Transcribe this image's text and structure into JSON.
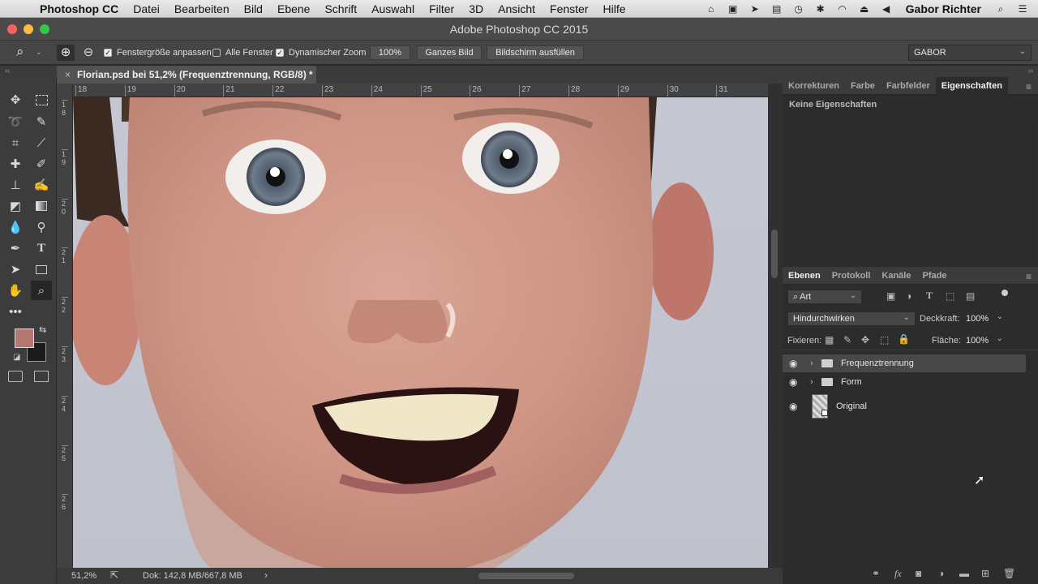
{
  "menubar": {
    "app": "Photoshop CC",
    "items": [
      "Datei",
      "Bearbeiten",
      "Bild",
      "Ebene",
      "Schrift",
      "Auswahl",
      "Filter",
      "3D",
      "Ansicht",
      "Fenster",
      "Hilfe"
    ],
    "user": "Gabor Richter"
  },
  "window": {
    "title": "Adobe Photoshop CC 2015"
  },
  "options": {
    "fit_window_label": "Fenstergröße anpassen",
    "fit_window_checked": true,
    "all_windows_label": "Alle Fenster",
    "all_windows_checked": false,
    "scrubby_zoom_label": "Dynamischer Zoom",
    "scrubby_zoom_checked": true,
    "zoom_100": "100%",
    "fit_screen": "Ganzes Bild",
    "fill_screen": "Bildschirm ausfüllen",
    "workspace": "GABOR"
  },
  "document": {
    "tab_title": "Florian.psd bei 51,2% (Frequenztrennung, RGB/8) *",
    "ruler_top": [
      "18",
      "19",
      "20",
      "21",
      "22",
      "23",
      "24",
      "25",
      "26",
      "27",
      "28",
      "29",
      "30",
      "31"
    ],
    "ruler_left": [
      "1 8",
      "1 9",
      "2 0",
      "2 1",
      "2 2",
      "2 3",
      "2 4",
      "2 5",
      "2 6"
    ]
  },
  "status": {
    "zoom": "51,2%",
    "doc": "Dok: 142,8 MB/667,8 MB"
  },
  "properties_panel": {
    "tabs": [
      "Korrekturen",
      "Farbe",
      "Farbfelder",
      "Eigenschaften"
    ],
    "active_tab": "Eigenschaften",
    "empty_text": "Keine Eigenschaften"
  },
  "layers_panel": {
    "tabs": [
      "Ebenen",
      "Protokoll",
      "Kanäle",
      "Pfade"
    ],
    "active_tab": "Ebenen",
    "filter_kind": "Art",
    "blend_mode": "Hindurchwirken",
    "opacity_label": "Deckkraft:",
    "opacity": "100%",
    "lock_label": "Fixieren:",
    "fill_label": "Fläche:",
    "fill": "100%",
    "layers": [
      {
        "name": "Frequenztrennung",
        "type": "group",
        "selected": true
      },
      {
        "name": "Form",
        "type": "group",
        "selected": false
      },
      {
        "name": "Original",
        "type": "smart-object",
        "selected": false
      }
    ]
  },
  "colors": {
    "foreground": "#b67771",
    "background": "#1b1b1b",
    "selected_layer": "#484848",
    "panel_bg": "#2c2c2c"
  }
}
